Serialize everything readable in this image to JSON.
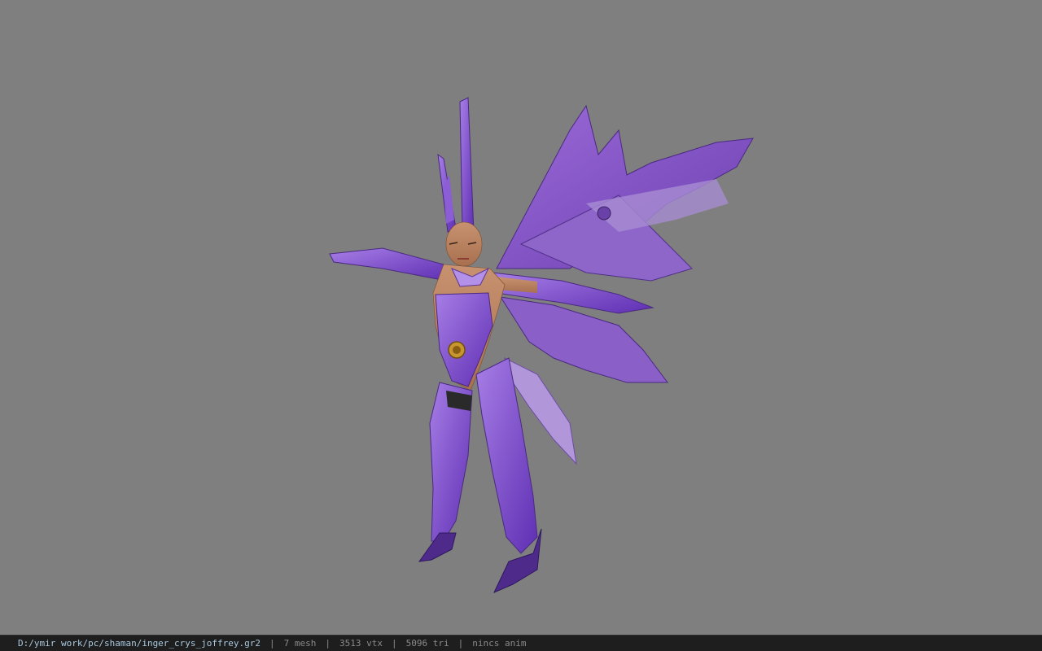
{
  "viewport": {
    "background": "#7f7f7f",
    "model_name": "inger_crys_joffrey",
    "armor_color": "#7a3fd6",
    "skin_color": "#c08a63"
  },
  "statusbar": {
    "file_path": "D:/ymir work/pc/shaman/inger_crys_joffrey.gr2",
    "separator": "|",
    "mesh_count": "7 mesh",
    "vertex_count": "3513 vtx",
    "triangle_count": "5096 tri",
    "anim_label": "nincs anim"
  }
}
